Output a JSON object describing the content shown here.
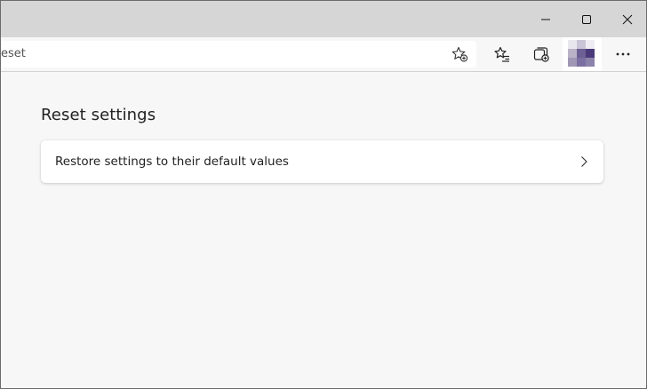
{
  "window": {
    "minimize_icon": "minimize-icon",
    "maximize_icon": "maximize-icon",
    "close_icon": "close-icon"
  },
  "toolbar": {
    "address_text": "eset",
    "icons": [
      "add-favorite-icon",
      "favorites-icon",
      "collections-icon",
      "profile-avatar",
      "more-icon"
    ]
  },
  "page": {
    "heading": "Reset settings",
    "reset_item_label": "Restore settings to their default values",
    "reset_item_icon": "chevron-right-icon"
  },
  "colors": {
    "titlebar": "#d6d6d6",
    "page_bg": "#f7f7f7",
    "card_bg": "#ffffff",
    "avatar_purple": "#4b3a7a"
  }
}
